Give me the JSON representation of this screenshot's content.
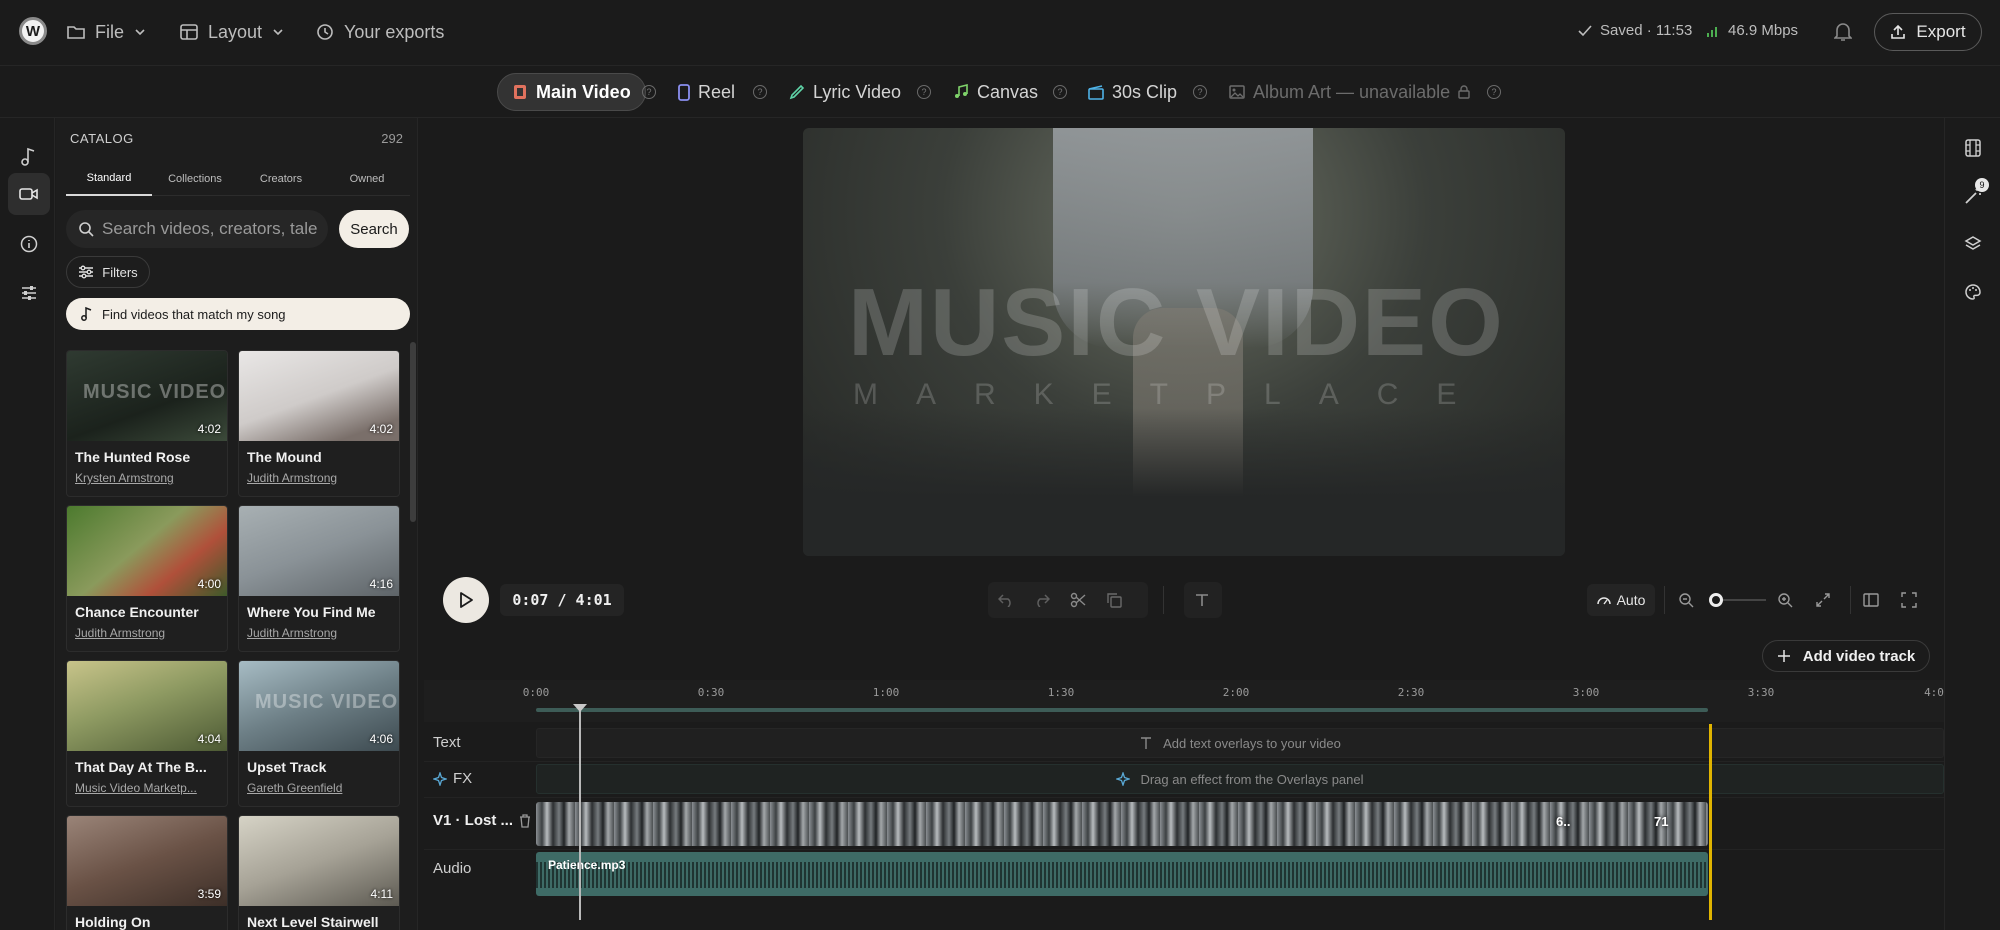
{
  "header": {
    "logo_letter": "W",
    "menu": [
      {
        "label": "File",
        "icon": "folder-icon",
        "has_chevron": true
      },
      {
        "label": "Layout",
        "icon": "layout-icon",
        "has_chevron": true
      },
      {
        "label": "Your exports",
        "icon": "history-icon",
        "has_chevron": false
      }
    ],
    "saved_status": "Saved · 11:53",
    "bandwidth": "46.9 Mbps",
    "export_label": "Export"
  },
  "output_tabs": [
    {
      "label": "Main Video",
      "icon": "film-icon",
      "active": true,
      "available": true
    },
    {
      "label": "Reel",
      "icon": "phone-icon",
      "active": false,
      "available": true
    },
    {
      "label": "Lyric Video",
      "icon": "pen-icon",
      "active": false,
      "available": true
    },
    {
      "label": "Canvas",
      "icon": "music-note-icon",
      "active": false,
      "available": true
    },
    {
      "label": "30s Clip",
      "icon": "clapper-icon",
      "active": false,
      "available": true
    },
    {
      "label": "Album Art — unavailable",
      "icon": "image-icon",
      "active": false,
      "available": false
    }
  ],
  "catalog": {
    "heading": "CATALOG",
    "count": "292",
    "tabs": [
      "Standard",
      "Collections",
      "Creators",
      "Owned"
    ],
    "active_tab": "Standard",
    "search_placeholder": "Search videos, creators, tale",
    "search_button": "Search",
    "filters_label": "Filters",
    "match_song_label": "Find videos that match my song",
    "videos": [
      {
        "title": "The Hunted Rose",
        "author": "Krysten Armstrong",
        "duration": "4:02",
        "watermark": "MUSIC VIDEO"
      },
      {
        "title": "The Mound",
        "author": "Judith Armstrong",
        "duration": "4:02",
        "watermark": ""
      },
      {
        "title": "Chance Encounter",
        "author": "Judith Armstrong",
        "duration": "4:00",
        "watermark": ""
      },
      {
        "title": "Where You Find Me",
        "author": "Judith Armstrong",
        "duration": "4:16",
        "watermark": ""
      },
      {
        "title": "That Day At The B...",
        "author": "Music Video Marketp...",
        "duration": "4:04",
        "watermark": ""
      },
      {
        "title": "Upset Track",
        "author": "Gareth Greenfield",
        "duration": "4:06",
        "watermark": "MUSIC VIDEO"
      },
      {
        "title": "Holding On",
        "author": "",
        "duration": "3:59",
        "watermark": ""
      },
      {
        "title": "Next Level Stairwell",
        "author": "",
        "duration": "4:11",
        "watermark": ""
      }
    ]
  },
  "preview": {
    "watermark_title": "MUSIC VIDEO",
    "watermark_sub": "MARKETPLACE"
  },
  "player": {
    "timecode": "0:07 / 4:01",
    "auto_label": "Auto",
    "add_track_label": "Add video track"
  },
  "timeline": {
    "ticks": [
      "0:00",
      "0:30",
      "1:00",
      "1:30",
      "2:00",
      "2:30",
      "3:00",
      "3:30",
      "4:0"
    ],
    "tracks": {
      "text_label": "Text",
      "text_hint": "Add text overlays to your video",
      "fx_label": "FX",
      "fx_hint": "Drag an effect from the Overlays panel",
      "video_label": "V1 · Lost ...",
      "video_segments": [
        "6..",
        "71"
      ],
      "audio_label": "Audio",
      "audio_file": "Patience.mp3"
    }
  },
  "right_rail": {
    "effects_badge": "9"
  },
  "colors": {
    "accent_audio": "#3e6b66",
    "end_marker": "#e0b400",
    "cta_bg": "#f3eee6"
  }
}
